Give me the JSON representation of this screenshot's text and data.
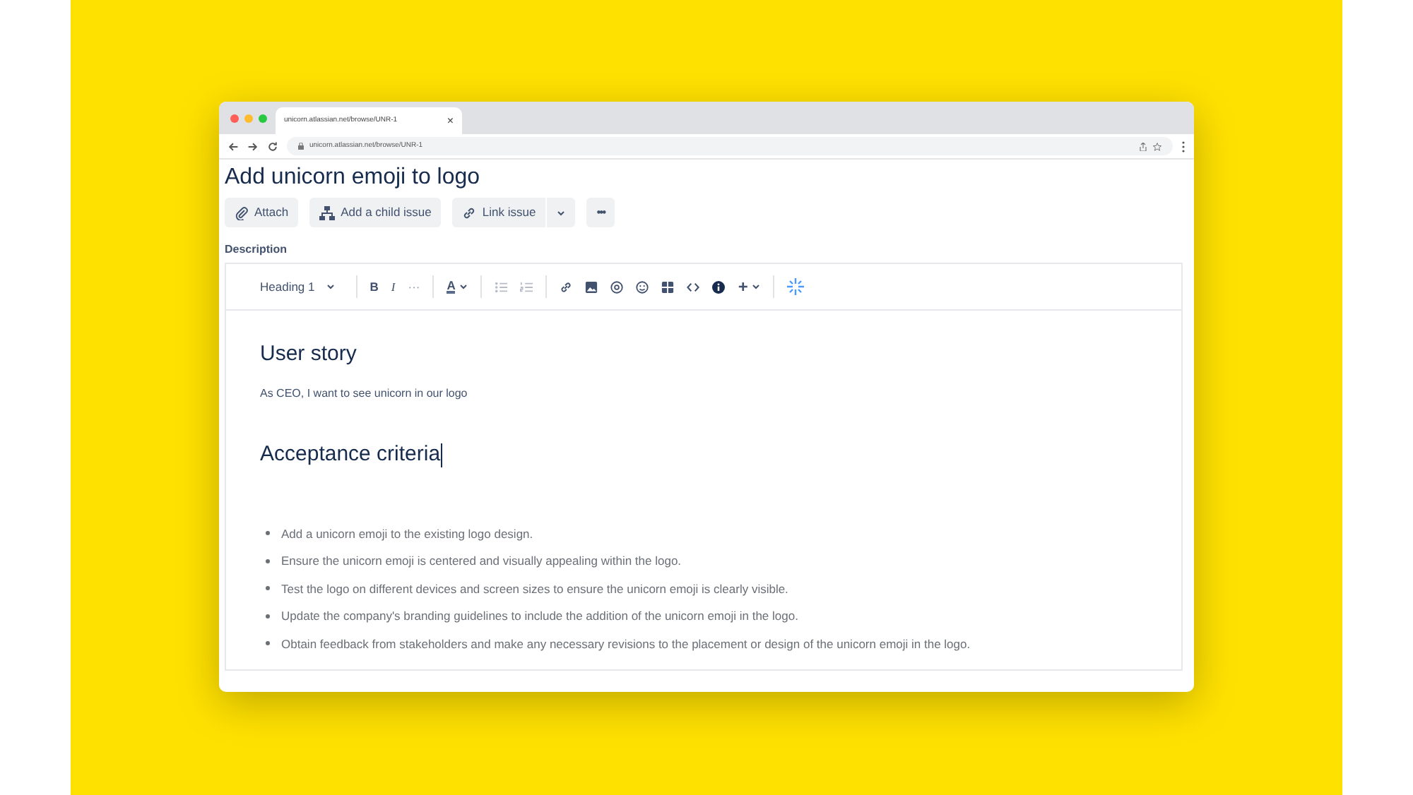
{
  "browser": {
    "tab_title": "unicorn.atlassian.net/browse/UNR-1",
    "tab_close": "×",
    "url": "unicorn.atlassian.net/browse/UNR-1"
  },
  "issue": {
    "title": "Add unicorn emoji to logo",
    "actions": [
      {
        "kind": "attach",
        "label": "Attach"
      },
      {
        "kind": "child",
        "label": "Add a child issue"
      },
      {
        "kind": "link",
        "label": "Link issue"
      }
    ],
    "more": "•••",
    "description_label": "Description"
  },
  "toolbar": {
    "heading": "Heading 1",
    "bold": "B",
    "italic": "I",
    "more": "···",
    "text_color": "A",
    "insert": "+"
  },
  "content": {
    "heading_1": "User story",
    "story": "As CEO, I want to see unicorn in our logo",
    "heading_2": "Acceptance criteria",
    "criteria": [
      "Add a unicorn emoji to the existing logo design.",
      "Ensure the unicorn emoji is centered and visually appealing within the logo.",
      "Test the logo on different devices and screen sizes to ensure the unicorn emoji is clearly visible.",
      "Update the company's branding guidelines to include the addition of the unicorn emoji in the logo.",
      "Obtain feedback from stakeholders and make any necessary revisions to the placement or design of the unicorn emoji in the logo."
    ]
  }
}
